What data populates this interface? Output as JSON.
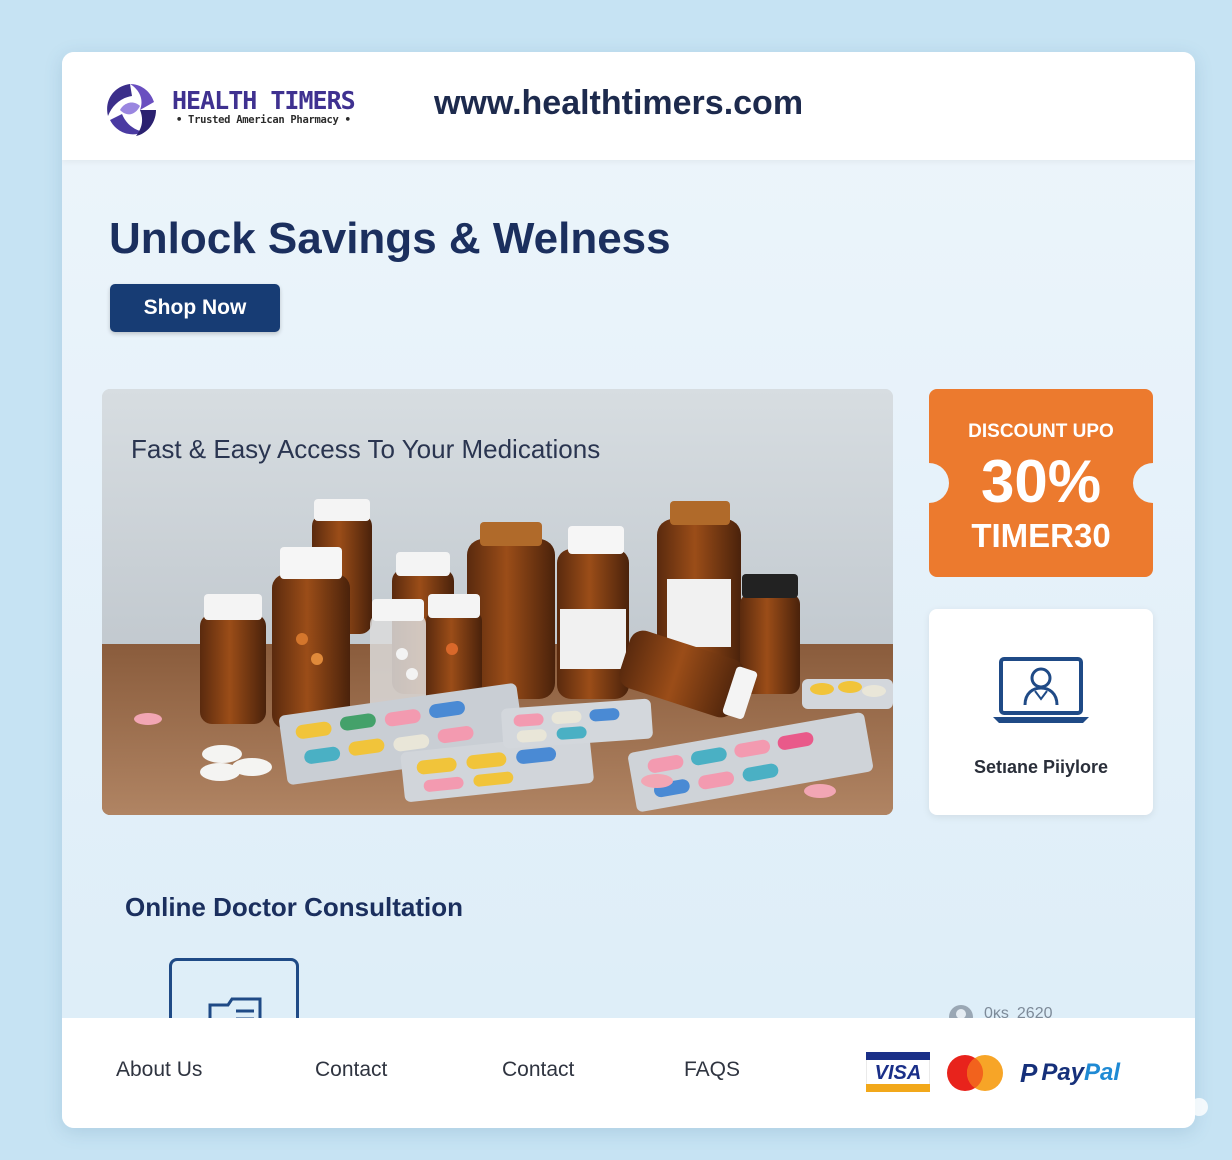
{
  "header": {
    "brand_name": "HEALTH TIMERS",
    "brand_tagline": "• Trusted American Pharmacy •",
    "site_url": "www.healthtimers.com"
  },
  "hero": {
    "title": "Unlock Savings & Welness",
    "shop_button": "Shop Now",
    "banner_text": "Fast & Easy Access To Your Medications"
  },
  "discount": {
    "label": "DISCOUNT UPO",
    "value": "30%",
    "code": "TIMER30"
  },
  "consult_card": {
    "label": "Setıane Piiylore"
  },
  "section": {
    "title": "Online Doctor Consultation"
  },
  "partial_stat": {
    "prefix": "0ᴋs",
    "value": "2620"
  },
  "footer": {
    "links": [
      "About Us",
      "Contact",
      "Contact",
      "FAQS"
    ],
    "payments": {
      "visa": "VISA",
      "paypal_p": "P",
      "paypal_pay": "Pay",
      "paypal_pal": "Pal"
    }
  },
  "colors": {
    "brand_purple": "#3f3190",
    "navy": "#173c74",
    "discount_orange": "#ec7a2e",
    "page_bg": "#c6e3f3"
  },
  "icons": [
    "health-timers-logo-icon",
    "doctor-laptop-icon",
    "document-folder-icon",
    "mastercard-icon",
    "paypal-icon"
  ]
}
